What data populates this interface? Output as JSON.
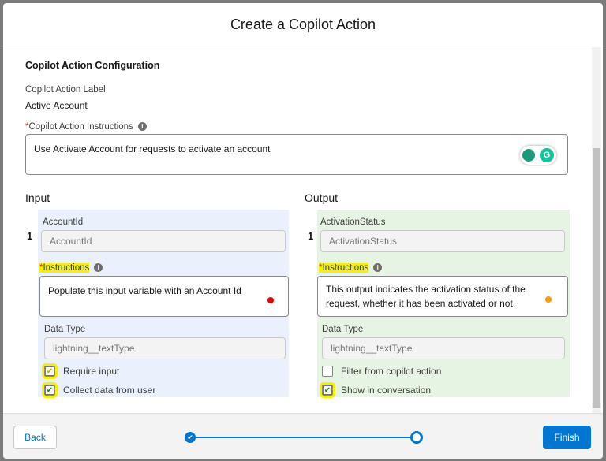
{
  "modal": {
    "title": "Create a Copilot Action"
  },
  "config": {
    "section_title": "Copilot Action Configuration",
    "label_label": "Copilot Action Label",
    "label_value": "Active Account",
    "instructions_label": "Copilot Action Instructions",
    "instructions_value": "Use Activate Account for requests to activate an account"
  },
  "input": {
    "heading": "Input",
    "index": "1",
    "name_label": "AccountId",
    "name_value": "AccountId",
    "instructions_label": "Instructions",
    "instructions_value": "Populate this input variable with an Account Id",
    "data_type_label": "Data Type",
    "data_type_value": "lightning__textType",
    "require_input": {
      "label": "Require input",
      "checked": true
    },
    "collect_data": {
      "label": "Collect data from user",
      "checked": true
    }
  },
  "output": {
    "heading": "Output",
    "index": "1",
    "name_label": "ActivationStatus",
    "name_value": "ActivationStatus",
    "instructions_label": "Instructions",
    "instructions_value": "This output indicates the activation status of the request, whether it has been activated or not.",
    "data_type_label": "Data Type",
    "data_type_value": "lightning__textType",
    "filter": {
      "label": "Filter from copilot action",
      "checked": false
    },
    "show": {
      "label": "Show in conversation",
      "checked": true
    }
  },
  "footer": {
    "back": "Back",
    "finish": "Finish",
    "progress_step": 2,
    "progress_total": 2
  },
  "colors": {
    "accent": "#0176d3",
    "input_bg": "#eaf1fd",
    "output_bg": "#e6f4e3",
    "highlight": "#f5f200"
  }
}
